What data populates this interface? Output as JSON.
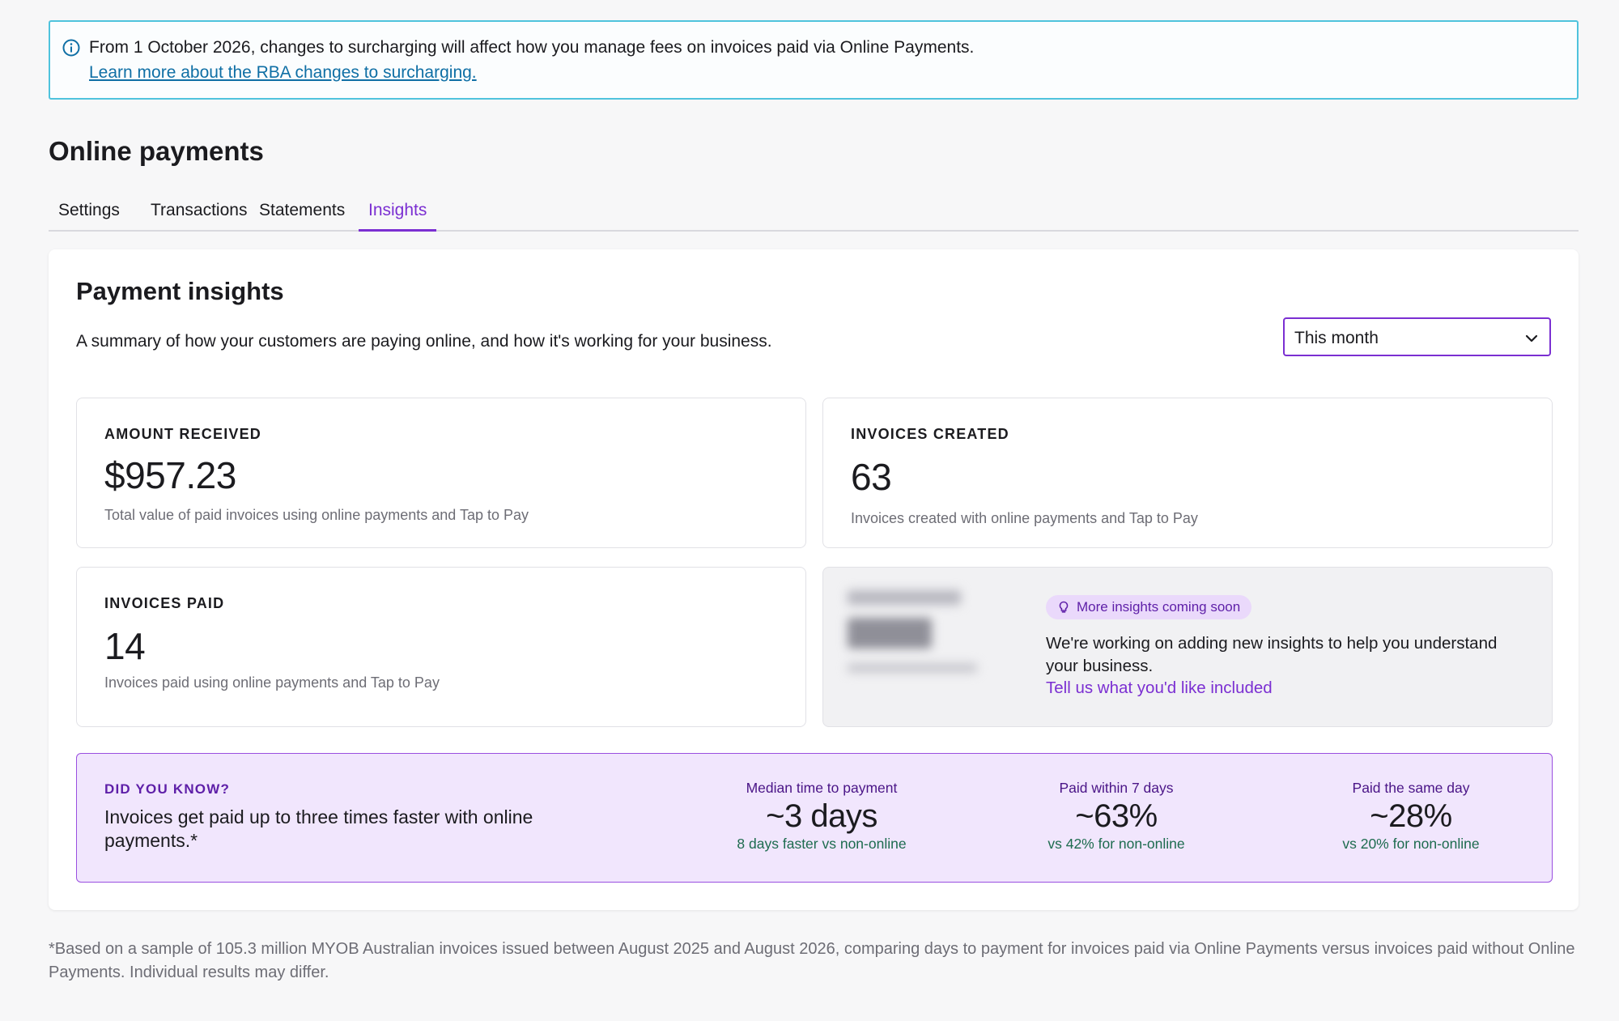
{
  "banner": {
    "message": "From 1 October 2026, changes to surcharging will affect how you manage fees on invoices paid via Online Payments.",
    "link_text": "Learn more about the RBA changes to surcharging."
  },
  "page": {
    "title": "Online payments",
    "tabs": [
      {
        "label": "Settings",
        "active": false
      },
      {
        "label": "Transactions",
        "active": false
      },
      {
        "label": "Statements",
        "active": false
      },
      {
        "label": "Insights",
        "active": true
      }
    ]
  },
  "insights": {
    "title": "Payment insights",
    "description": "A summary of how your customers are paying online, and how it's working for your business.",
    "period_select": {
      "selected": "This month"
    },
    "tiles": {
      "amount_received": {
        "label": "AMOUNT RECEIVED",
        "value": "$957.23",
        "description": "Total value of paid invoices using online payments and Tap to Pay"
      },
      "invoices_created": {
        "label": "INVOICES CREATED",
        "value": "63",
        "description": "Invoices created with online payments and Tap to Pay"
      },
      "invoices_paid": {
        "label": "INVOICES PAID",
        "value": "14",
        "description": "Invoices paid using online payments and Tap to Pay"
      }
    },
    "coming_soon": {
      "badge": "More insights coming soon",
      "text": "We're working on adding new insights to help you understand your business.",
      "link_text": "Tell us what you'd like included"
    },
    "did_you_know": {
      "kicker": "DID YOU KNOW?",
      "headline": "Invoices get paid up to three times faster with online payments.*",
      "metrics": [
        {
          "label": "Median time to payment",
          "value": "~3 days",
          "sub": "8 days faster vs non-online"
        },
        {
          "label": "Paid within 7 days",
          "value": "~63%",
          "sub": "vs 42% for non-online"
        },
        {
          "label": "Paid the same day",
          "value": "~28%",
          "sub": "vs 20% for non-online"
        }
      ]
    }
  },
  "footnote": "*Based on a sample of 105.3 million MYOB Australian invoices issued between August 2025 and August 2026, comparing days to payment for invoices paid via Online Payments versus invoices paid without Online Payments. Individual results may differ.",
  "colors": {
    "accent": "#7b2fd2",
    "banner_border": "#4fc3dd",
    "link_blue": "#0f6fa5",
    "did_you_know_bg": "#f1e6fd",
    "positive_green": "#1d6b4e"
  },
  "icons": {
    "banner": "info-icon",
    "select": "chevron-down-icon",
    "badge": "lightbulb-icon"
  }
}
